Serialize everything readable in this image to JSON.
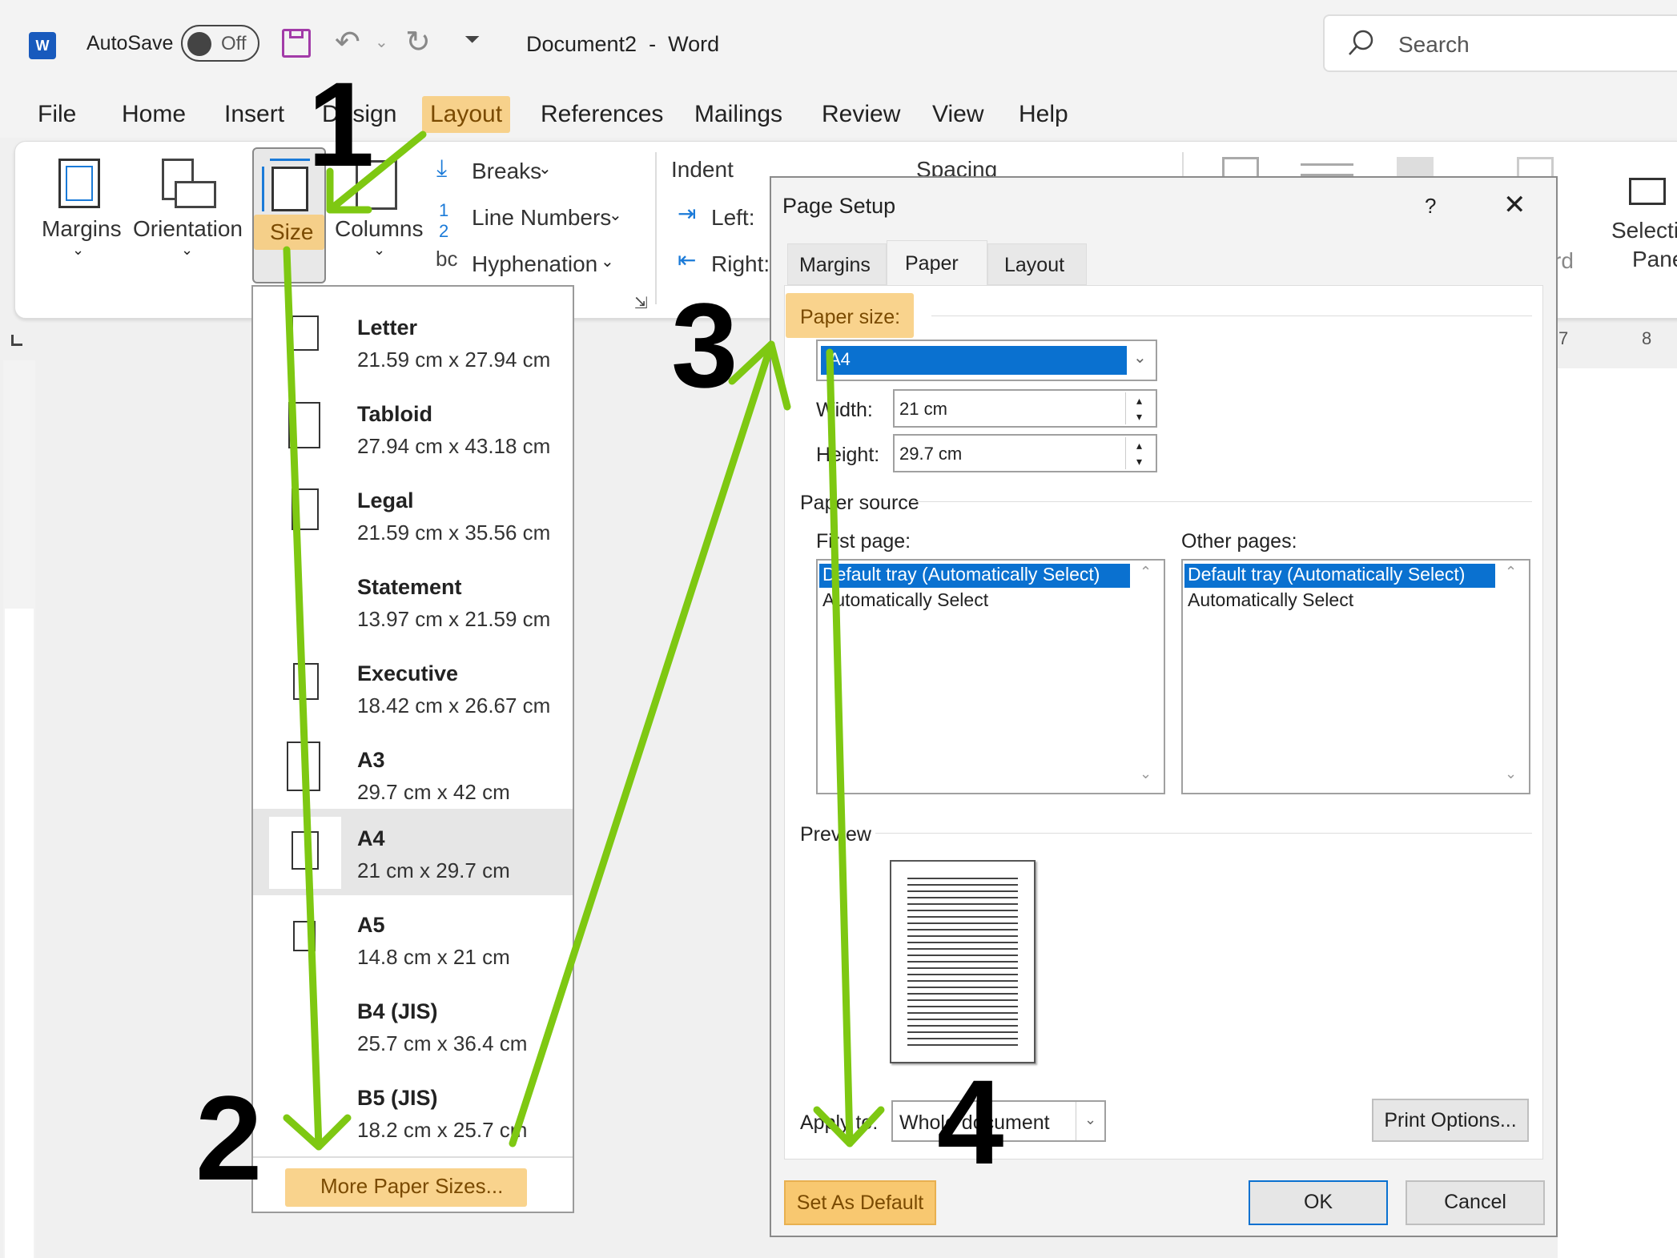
{
  "titlebar": {
    "autosave_label": "AutoSave",
    "autosave_state": "Off",
    "document_title": "Document2  -  Word",
    "search_placeholder": "Search"
  },
  "menu": [
    "File",
    "Home",
    "Insert",
    "Design",
    "Layout",
    "References",
    "Mailings",
    "Review",
    "View",
    "Help"
  ],
  "ribbon": {
    "margins": "Margins",
    "orientation": "Orientation",
    "size": "Size",
    "columns": "Columns",
    "breaks": "Breaks",
    "line_numbers": "Line Numbers",
    "hyphenation": "Hyphenation",
    "indent": "Indent",
    "left": "Left:",
    "right": "Right:",
    "spacing": "Spacing",
    "selection": "Selecti",
    "pane": "Pane",
    "rd": "rd"
  },
  "ruler": [
    "7",
    "8"
  ],
  "size_menu": {
    "items": [
      {
        "name": "Letter",
        "dim": "21.59 cm x 27.94 cm"
      },
      {
        "name": "Tabloid",
        "dim": "27.94 cm x 43.18 cm"
      },
      {
        "name": "Legal",
        "dim": "21.59 cm x 35.56 cm"
      },
      {
        "name": "Statement",
        "dim": "13.97 cm x 21.59 cm"
      },
      {
        "name": "Executive",
        "dim": "18.42 cm x 26.67 cm"
      },
      {
        "name": "A3",
        "dim": "29.7 cm x 42 cm"
      },
      {
        "name": "A4",
        "dim": "21 cm x 29.7 cm"
      },
      {
        "name": "A5",
        "dim": "14.8 cm x 21 cm"
      },
      {
        "name": "B4 (JIS)",
        "dim": "25.7 cm x 36.4 cm"
      },
      {
        "name": "B5 (JIS)",
        "dim": "18.2 cm x 25.7 cm"
      }
    ],
    "selected": "A4",
    "more": "More Paper Sizes..."
  },
  "dialog": {
    "title": "Page Setup",
    "help": "?",
    "tabs": [
      "Margins",
      "Paper",
      "Layout"
    ],
    "active_tab": "Paper",
    "paper_size_label": "Paper size:",
    "paper_size_value": "A4",
    "width_label": "Width:",
    "width_value": "21 cm",
    "height_label": "Height:",
    "height_value": "29.7 cm",
    "paper_source": "Paper source",
    "first_page": "First page:",
    "other_pages": "Other pages:",
    "tray_options": [
      "Default tray (Automatically Select)",
      "Automatically Select"
    ],
    "preview": "Preview",
    "apply_to_label": "Apply to:",
    "apply_to_value": "Whole document",
    "print_options": "Print Options...",
    "set_default": "Set As Default",
    "ok": "OK",
    "cancel": "Cancel"
  },
  "steps": [
    "1",
    "2",
    "3",
    "4"
  ],
  "colors": {
    "arrow": "#7ec812",
    "highlight": "#f8c870",
    "selection": "#0a71d0"
  }
}
